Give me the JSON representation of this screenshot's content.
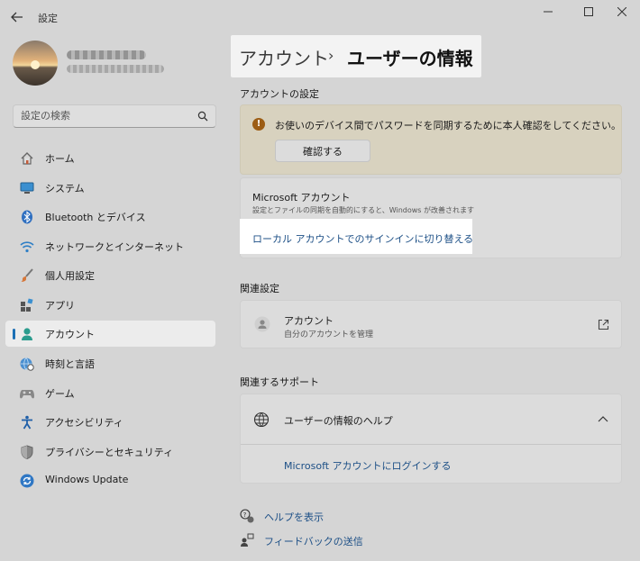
{
  "window": {
    "title": "設定",
    "back_icon": "back-arrow-icon",
    "minimize_icon": "minimize-icon",
    "maximize_icon": "maximize-icon",
    "close_icon": "close-icon"
  },
  "profile": {
    "avatar": "sunset-avatar-image"
  },
  "search": {
    "placeholder": "設定の検索",
    "icon": "search-icon"
  },
  "sidebar": {
    "items": [
      {
        "label": "ホーム",
        "icon": "home-icon"
      },
      {
        "label": "システム",
        "icon": "system-icon"
      },
      {
        "label": "Bluetooth とデバイス",
        "icon": "bluetooth-icon"
      },
      {
        "label": "ネットワークとインターネット",
        "icon": "wifi-icon"
      },
      {
        "label": "個人用設定",
        "icon": "brush-icon"
      },
      {
        "label": "アプリ",
        "icon": "apps-icon"
      },
      {
        "label": "アカウント",
        "icon": "account-icon",
        "selected": true
      },
      {
        "label": "時刻と言語",
        "icon": "globe-clock-icon"
      },
      {
        "label": "ゲーム",
        "icon": "gamepad-icon"
      },
      {
        "label": "アクセシビリティ",
        "icon": "accessibility-icon"
      },
      {
        "label": "プライバシーとセキュリティ",
        "icon": "shield-icon"
      },
      {
        "label": "Windows Update",
        "icon": "update-icon"
      }
    ]
  },
  "header": {
    "parent": "アカウント",
    "separator": "›",
    "current": "ユーザーの情報"
  },
  "account_settings": {
    "section_title": "アカウントの設定",
    "warning_text": "お使いのデバイス間でパスワードを同期するために本人確認をしてください。",
    "verify_button": "確認する",
    "ms_title": "Microsoft アカウント",
    "ms_desc": "設定とファイルの同期を自動的にすると、Windows が改善されます",
    "local_link": "ローカル アカウントでのサインインに切り替える"
  },
  "related": {
    "section_title": "関連設定",
    "account_title": "アカウント",
    "account_desc": "自分のアカウントを管理"
  },
  "support": {
    "section_title": "関連するサポート",
    "help_title": "ユーザーの情報のヘルプ",
    "help_link": "Microsoft アカウントにログインする"
  },
  "footer": {
    "help": "ヘルプを表示",
    "feedback": "フィードバックの送信"
  },
  "colors": {
    "accent": "#1c6fb5",
    "link": "#1c4f86",
    "warning_bg": "#d8d2bf",
    "background": "#d5d5d5"
  }
}
